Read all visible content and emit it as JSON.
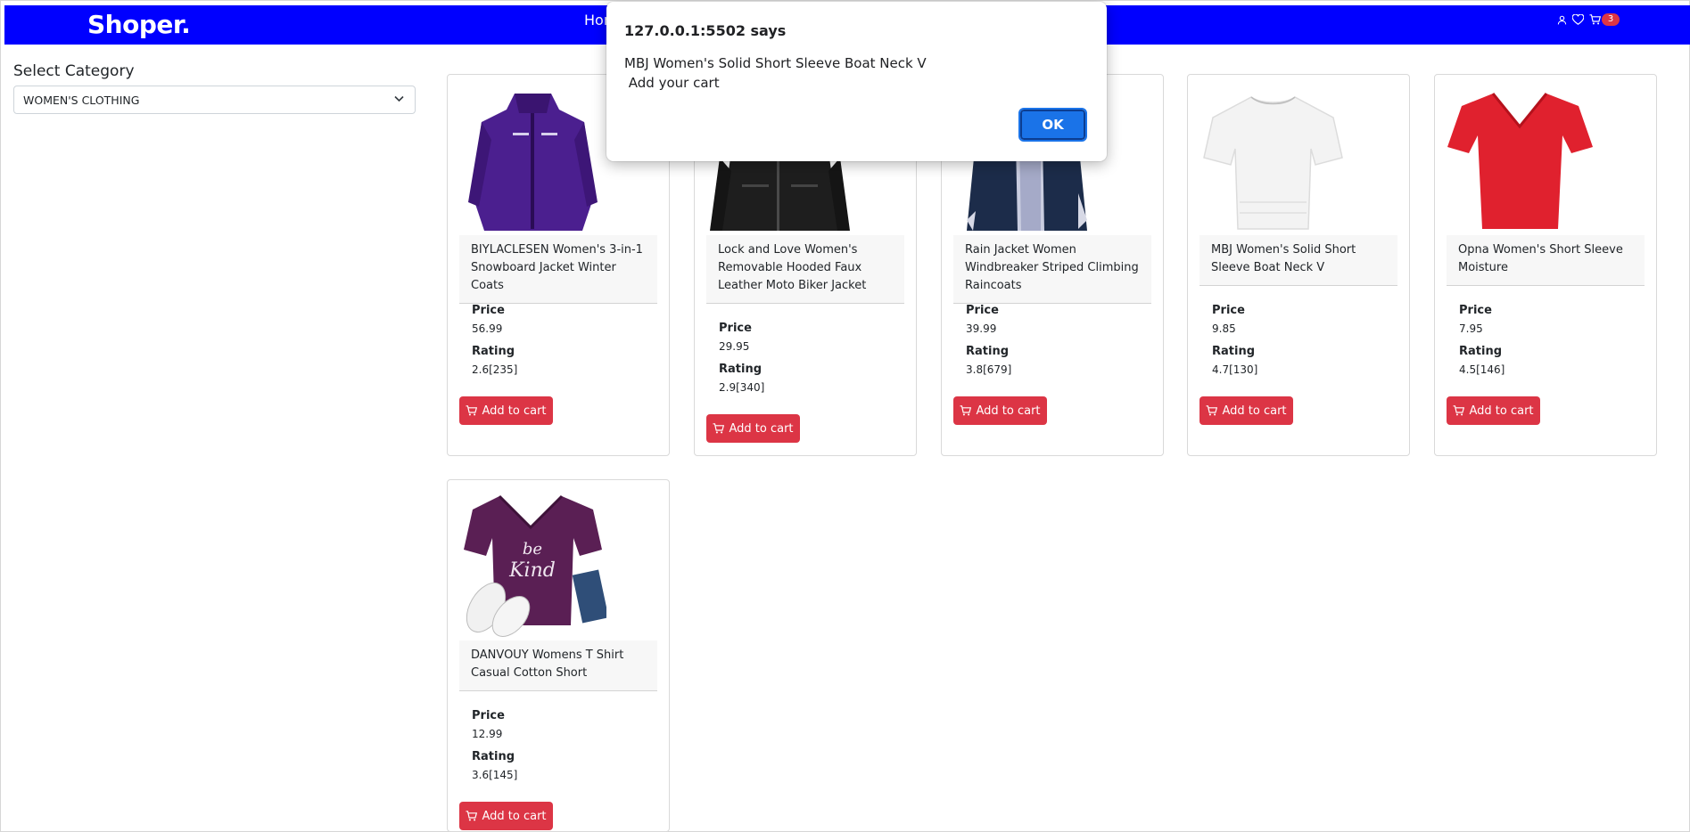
{
  "navbar": {
    "brand": "Shoper.",
    "home_link": "Hom",
    "cart_count": "3",
    "bg_color": "#0000ff"
  },
  "sidebar": {
    "title": "Select Category",
    "selected_category": "WOMEN'S CLOTHING"
  },
  "products": [
    {
      "name": "BIYLACLESEN Women's 3-in-1 Snowboard Jacket Winter Coats",
      "price_label": "Price",
      "price": "56.99",
      "rating_label": "Rating",
      "rating": "2.6[235]",
      "button": "Add to cart",
      "image": "purple-jacket-image"
    },
    {
      "name": "Lock and Love Women's Removable Hooded Faux Leather Moto Biker Jacket",
      "price_label": "Price",
      "price": "29.95",
      "rating_label": "Rating",
      "rating": "2.9[340]",
      "button": "Add to cart",
      "image": "black-leather-jacket-image"
    },
    {
      "name": "Rain Jacket Women Windbreaker Striped Climbing Raincoats",
      "price_label": "Price",
      "price": "39.99",
      "rating_label": "Rating",
      "rating": "3.8[679]",
      "button": "Add to cart",
      "image": "navy-raincoat-image"
    },
    {
      "name": "MBJ Women's Solid Short Sleeve Boat Neck V",
      "price_label": "Price",
      "price": "9.85",
      "rating_label": "Rating",
      "rating": "4.7[130]",
      "button": "Add to cart",
      "image": "white-tshirt-image"
    },
    {
      "name": "Opna Women's Short Sleeve Moisture",
      "price_label": "Price",
      "price": "7.95",
      "rating_label": "Rating",
      "rating": "4.5[146]",
      "button": "Add to cart",
      "image": "red-vneck-tshirt-image"
    },
    {
      "name": "DANVOUY Womens T Shirt Casual Cotton Short",
      "price_label": "Price",
      "price": "12.99",
      "rating_label": "Rating",
      "rating": "3.6[145]",
      "button": "Add to cart",
      "image": "purple-be-kind-tshirt-image"
    }
  ],
  "dialog": {
    "title": "127.0.0.1:5502 says",
    "message": "MBJ Women's Solid Short Sleeve Boat Neck V\n Add your cart",
    "ok_label": "OK"
  },
  "colors": {
    "accent_red": "#dc3545",
    "dialog_button": "#1a73e8"
  }
}
